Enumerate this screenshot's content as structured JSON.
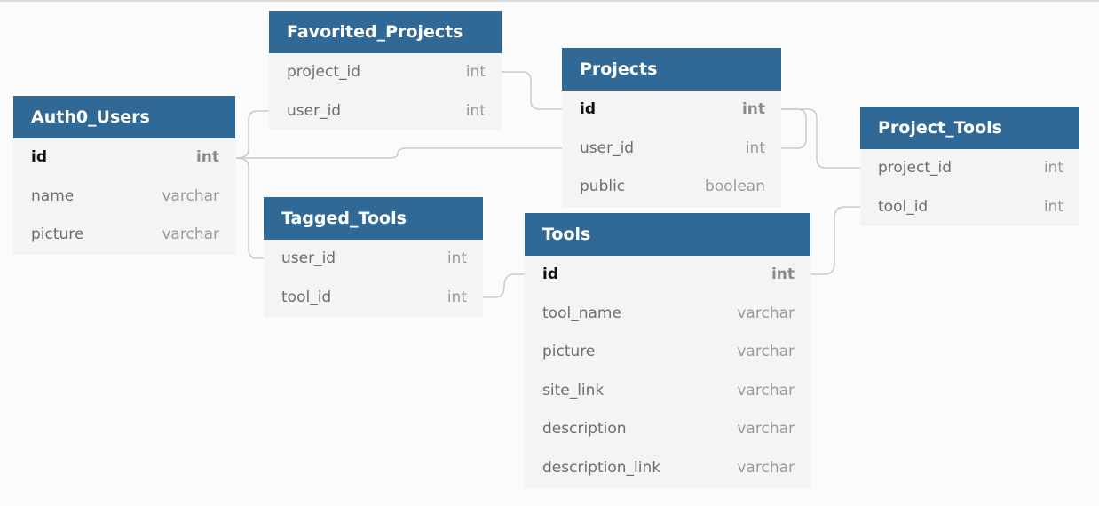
{
  "tables": {
    "auth0_users": {
      "name": "Auth0_Users",
      "fields": [
        {
          "name": "id",
          "type": "int",
          "pk": true
        },
        {
          "name": "name",
          "type": "varchar"
        },
        {
          "name": "picture",
          "type": "varchar"
        }
      ]
    },
    "favorited_projects": {
      "name": "Favorited_Projects",
      "fields": [
        {
          "name": "project_id",
          "type": "int"
        },
        {
          "name": "user_id",
          "type": "int"
        }
      ]
    },
    "projects": {
      "name": "Projects",
      "fields": [
        {
          "name": "id",
          "type": "int",
          "pk": true
        },
        {
          "name": "user_id",
          "type": "int"
        },
        {
          "name": "public",
          "type": "boolean"
        }
      ]
    },
    "project_tools": {
      "name": "Project_Tools",
      "fields": [
        {
          "name": "project_id",
          "type": "int"
        },
        {
          "name": "tool_id",
          "type": "int"
        }
      ]
    },
    "tagged_tools": {
      "name": "Tagged_Tools",
      "fields": [
        {
          "name": "user_id",
          "type": "int"
        },
        {
          "name": "tool_id",
          "type": "int"
        }
      ]
    },
    "tools": {
      "name": "Tools",
      "fields": [
        {
          "name": "id",
          "type": "int",
          "pk": true
        },
        {
          "name": "tool_name",
          "type": "varchar"
        },
        {
          "name": "picture",
          "type": "varchar"
        },
        {
          "name": "site_link",
          "type": "varchar"
        },
        {
          "name": "description",
          "type": "varchar"
        },
        {
          "name": "description_link",
          "type": "varchar"
        }
      ]
    }
  },
  "colors": {
    "header_bg": "#306896",
    "canvas_bg": "#fbfbfb",
    "connector": "#c9c9c9"
  }
}
